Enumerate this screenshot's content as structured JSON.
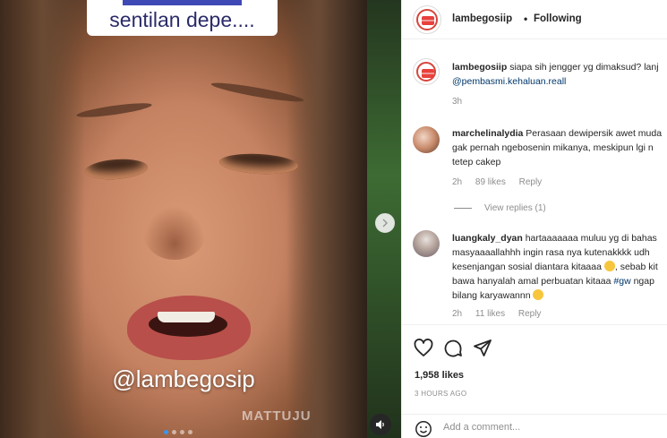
{
  "media": {
    "caption_top": "sentilan depe....",
    "overlay_handle": "@lambegosip",
    "watermark": "MATTUJU"
  },
  "header": {
    "username": "lambegosiip",
    "separator": "•",
    "follow_status": "Following"
  },
  "caption": {
    "username": "lambegosiip",
    "text": "siapa sih jengger yg dimaksud? lanj",
    "mention": "@pembasmi.kehaluan.reall",
    "time": "3h"
  },
  "comments": [
    {
      "username": "marchelinalydia",
      "text": "Perasaan dewipersik awet muda gak pernah ngebosenin mikanya, meskipun lgi n tetep cakep",
      "time": "2h",
      "likes": "89 likes",
      "reply": "Reply",
      "view_replies": "View replies (1)"
    },
    {
      "username": "luangkaly_dyan",
      "text_1": "hartaaaaaaa muluu yg di bahas masyaaaallahhh ingin rasa nya kutenakkkk udh kesenjangan sosial diantara kitaaaa",
      "text_2": ", sebab kit bawa hanyalah amal perbuatan kitaaa",
      "hashtag": "#gw",
      "text_3": "ngap bilang karyawannn",
      "time": "2h",
      "likes": "11 likes",
      "reply": "Reply"
    }
  ],
  "actions": {
    "likes": "1,958 likes",
    "posted": "3 HOURS AGO"
  },
  "add_comment": {
    "placeholder": "Add a comment..."
  },
  "icons": {
    "like": "heart-icon",
    "comment": "comment-bubble-icon",
    "share": "paper-plane-icon",
    "emoji": "smiley-icon",
    "sound": "speaker-icon",
    "next": "chevron-right-icon"
  },
  "colors": {
    "link": "#00376b",
    "muted": "#8e8e8e",
    "active_dot": "#3897f0"
  }
}
